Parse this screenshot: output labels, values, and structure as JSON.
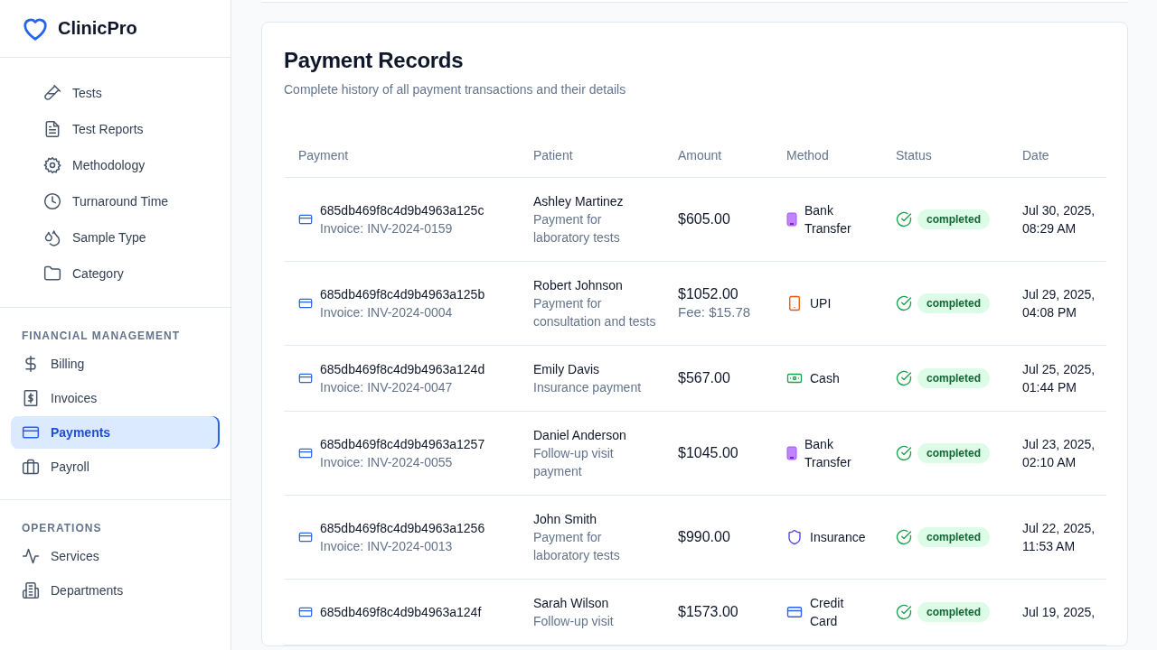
{
  "brand": {
    "name": "ClinicPro"
  },
  "sidebar": {
    "groups": [
      {
        "items": [
          {
            "label": "Tests",
            "selected": false
          },
          {
            "label": "Test Reports",
            "selected": false
          },
          {
            "label": "Methodology",
            "selected": false
          },
          {
            "label": "Turnaround Time",
            "selected": false
          },
          {
            "label": "Sample Type",
            "selected": false
          },
          {
            "label": "Category",
            "selected": false
          }
        ]
      },
      {
        "heading": "FINANCIAL MANAGEMENT",
        "items": [
          {
            "label": "Billing",
            "selected": false
          },
          {
            "label": "Invoices",
            "selected": false
          },
          {
            "label": "Payments",
            "selected": true
          },
          {
            "label": "Payroll",
            "selected": false
          }
        ]
      },
      {
        "heading": "OPERATIONS",
        "items": [
          {
            "label": "Services",
            "selected": false
          },
          {
            "label": "Departments",
            "selected": false
          }
        ]
      }
    ]
  },
  "card": {
    "title": "Payment Records",
    "subtitle": "Complete history of all payment transactions and their details"
  },
  "table": {
    "columns": [
      "Payment",
      "Patient",
      "Amount",
      "Method",
      "Status",
      "Date"
    ],
    "rows": [
      {
        "id": "685db469f8c4d9b4963a125c",
        "invoice": "Invoice: INV-2024-0159",
        "patient": "Ashley Martinez",
        "note": "Payment for laboratory tests",
        "amount": "$605.00",
        "method": {
          "kind": "bank",
          "label": "Bank Transfer"
        },
        "status": "completed",
        "date": "Jul 30, 2025, 08:29 AM"
      },
      {
        "id": "685db469f8c4d9b4963a125b",
        "invoice": "Invoice: INV-2024-0004",
        "patient": "Robert Johnson",
        "note": "Payment for consultation and tests",
        "amount": "$1052.00",
        "fee": "Fee: $15.78",
        "method": {
          "kind": "upi",
          "label": "UPI"
        },
        "status": "completed",
        "date": "Jul 29, 2025, 04:08 PM"
      },
      {
        "id": "685db469f8c4d9b4963a124d",
        "invoice": "Invoice: INV-2024-0047",
        "patient": "Emily Davis",
        "note": "Insurance payment",
        "amount": "$567.00",
        "method": {
          "kind": "cash",
          "label": "Cash"
        },
        "status": "completed",
        "date": "Jul 25, 2025, 01:44 PM"
      },
      {
        "id": "685db469f8c4d9b4963a1257",
        "invoice": "Invoice: INV-2024-0055",
        "patient": "Daniel Anderson",
        "note": "Follow-up visit payment",
        "amount": "$1045.00",
        "method": {
          "kind": "bank",
          "label": "Bank Transfer"
        },
        "status": "completed",
        "date": "Jul 23, 2025, 02:10 AM"
      },
      {
        "id": "685db469f8c4d9b4963a1256",
        "invoice": "Invoice: INV-2024-0013",
        "patient": "John Smith",
        "note": "Payment for laboratory tests",
        "amount": "$990.00",
        "method": {
          "kind": "insurance",
          "label": "Insurance"
        },
        "status": "completed",
        "date": "Jul 22, 2025, 11:53 AM"
      },
      {
        "id": "685db469f8c4d9b4963a124f",
        "patient": "Sarah Wilson",
        "note": "Follow-up visit",
        "amount": "$1573.00",
        "method": {
          "kind": "card",
          "label": "Credit Card"
        },
        "status": "completed",
        "date": "Jul 19, 2025,"
      }
    ]
  }
}
